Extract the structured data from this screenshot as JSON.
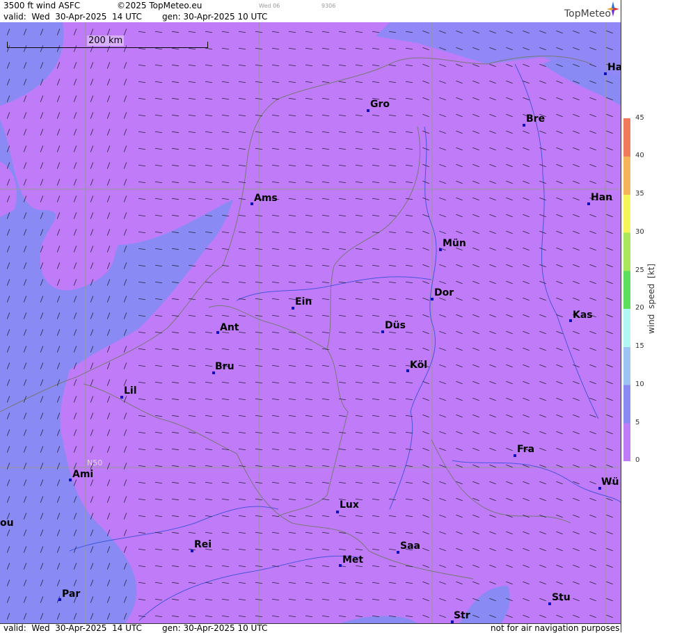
{
  "header": {
    "title": "3500 ft wind ASFC",
    "copyright": "©2025 TopMeteo.eu",
    "valid": "valid:  Wed  30-Apr-2025  14 UTC",
    "gen": "gen: 30-Apr-2025 10 UTC",
    "tab_day": "Wed 06",
    "tab_code": "9306",
    "brand": "TopMeteo"
  },
  "footer": {
    "valid": "valid:  Wed  30-Apr-2025  14 UTC",
    "gen": "gen: 30-Apr-2025 10 UTC",
    "disclaimer": "not for air navigation purposes"
  },
  "scale": {
    "label": "200 km"
  },
  "gridlabel": "N50",
  "legend": {
    "unit": "wind  speed  [kt]",
    "ticks": [
      "45",
      "40",
      "35",
      "30",
      "25",
      "20",
      "15",
      "10",
      "5",
      "0"
    ],
    "colors": [
      "#c07cf8",
      "#8a8af5",
      "#9dc3f5",
      "#b2f5f5",
      "#5ce05c",
      "#a8e85a",
      "#f5f55a",
      "#f5b35a",
      "#f07a5a"
    ]
  },
  "cities": [
    "Ha",
    "Gro",
    "Bre",
    "Ams",
    "Han",
    "Mün",
    "Dor",
    "Ein",
    "Kas",
    "Ant",
    "Düs",
    "Bru",
    "Köl",
    "Lil",
    "Fra",
    "Ami",
    "Wü",
    "Lux",
    "ou",
    "Rei",
    "Saa",
    "Met",
    "Par",
    "Stu",
    "Str"
  ]
}
